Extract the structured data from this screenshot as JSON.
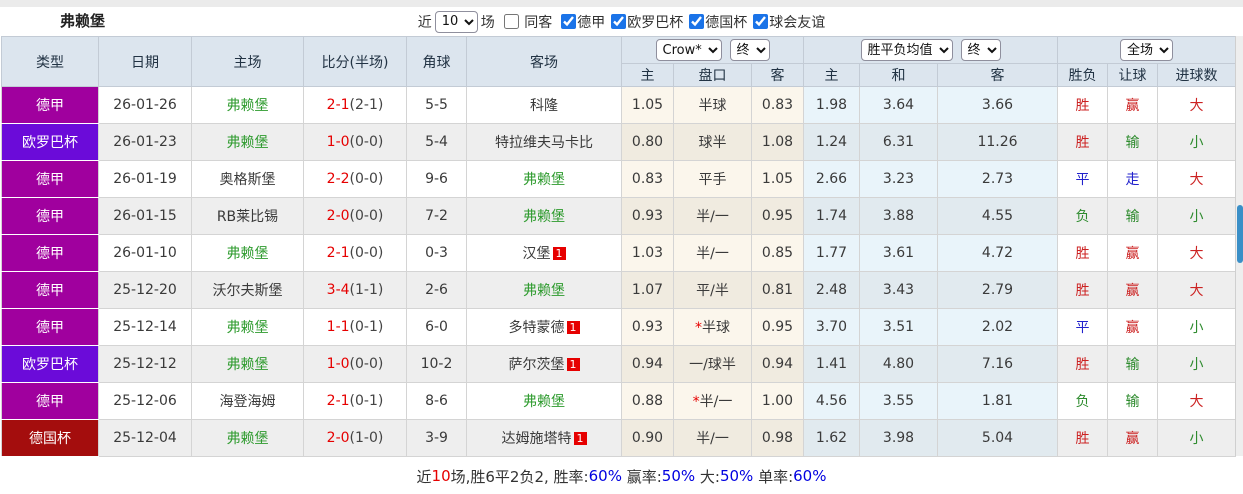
{
  "title": "弗赖堡",
  "topbar": {
    "recent_label": "近",
    "recent_value": "10",
    "games_label": "场",
    "same_opponent": {
      "label": "同客",
      "checked": false
    },
    "league_filters": [
      {
        "label": "德甲",
        "checked": true
      },
      {
        "label": "欧罗巴杯",
        "checked": true
      },
      {
        "label": "德国杯",
        "checked": true
      },
      {
        "label": "球会友谊",
        "checked": true
      }
    ]
  },
  "header": {
    "main_cols": [
      "类型",
      "日期",
      "主场",
      "比分(半场)",
      "角球",
      "客场"
    ],
    "odds_group": {
      "bookmaker_select": "Crow*",
      "time_select": "终"
    },
    "avg_group": {
      "name_select": "胜平负均值",
      "time_select": "终"
    },
    "result_group": {
      "scope_select": "全场"
    },
    "sub_cols": [
      "主",
      "盘口",
      "客",
      "主",
      "和",
      "客",
      "胜负",
      "让球",
      "进球数"
    ]
  },
  "highlight_team": "弗赖堡",
  "league_colors": {
    "德甲": "#a0009e",
    "欧罗巴杯": "#6b0bd9",
    "德国杯": "#a40d0d"
  },
  "value_colors": {
    "胜": "v-red",
    "平": "v-blue",
    "负": "v-green",
    "赢": "v-red",
    "走": "v-blue",
    "输": "v-green",
    "大": "v-red",
    "小": "v-green"
  },
  "rows": [
    {
      "league": "德甲",
      "date": "26-01-26",
      "home": "弗赖堡",
      "score": "2-1",
      "half": "(2-1)",
      "corners": "5-5",
      "away": "科隆",
      "away_badge": "",
      "odds_home": "1.05",
      "handicap": "半球",
      "handicap_star": false,
      "odds_away": "0.83",
      "avg_home": "1.98",
      "avg_draw": "3.64",
      "avg_away": "3.66",
      "result": "胜",
      "let_result": "赢",
      "goals": "大"
    },
    {
      "league": "欧罗巴杯",
      "date": "26-01-23",
      "home": "弗赖堡",
      "score": "1-0",
      "half": "(0-0)",
      "corners": "5-4",
      "away": "特拉维夫马卡比",
      "away_badge": "",
      "odds_home": "0.80",
      "handicap": "球半",
      "handicap_star": false,
      "odds_away": "1.08",
      "avg_home": "1.24",
      "avg_draw": "6.31",
      "avg_away": "11.26",
      "result": "胜",
      "let_result": "输",
      "goals": "小"
    },
    {
      "league": "德甲",
      "date": "26-01-19",
      "home": "奥格斯堡",
      "score": "2-2",
      "half": "(0-0)",
      "corners": "9-6",
      "away": "弗赖堡",
      "away_badge": "",
      "odds_home": "0.83",
      "handicap": "平手",
      "handicap_star": false,
      "odds_away": "1.05",
      "avg_home": "2.66",
      "avg_draw": "3.23",
      "avg_away": "2.73",
      "result": "平",
      "let_result": "走",
      "goals": "大"
    },
    {
      "league": "德甲",
      "date": "26-01-15",
      "home": "RB莱比锡",
      "score": "2-0",
      "half": "(0-0)",
      "corners": "7-2",
      "away": "弗赖堡",
      "away_badge": "",
      "odds_home": "0.93",
      "handicap": "半/一",
      "handicap_star": false,
      "odds_away": "0.95",
      "avg_home": "1.74",
      "avg_draw": "3.88",
      "avg_away": "4.55",
      "result": "负",
      "let_result": "输",
      "goals": "小"
    },
    {
      "league": "德甲",
      "date": "26-01-10",
      "home": "弗赖堡",
      "score": "2-1",
      "half": "(0-0)",
      "corners": "0-3",
      "away": "汉堡",
      "away_badge": "1",
      "odds_home": "1.03",
      "handicap": "半/一",
      "handicap_star": false,
      "odds_away": "0.85",
      "avg_home": "1.77",
      "avg_draw": "3.61",
      "avg_away": "4.72",
      "result": "胜",
      "let_result": "赢",
      "goals": "大"
    },
    {
      "league": "德甲",
      "date": "25-12-20",
      "home": "沃尔夫斯堡",
      "score": "3-4",
      "half": "(1-1)",
      "corners": "2-6",
      "away": "弗赖堡",
      "away_badge": "",
      "odds_home": "1.07",
      "handicap": "平/半",
      "handicap_star": false,
      "odds_away": "0.81",
      "avg_home": "2.48",
      "avg_draw": "3.43",
      "avg_away": "2.79",
      "result": "胜",
      "let_result": "赢",
      "goals": "大"
    },
    {
      "league": "德甲",
      "date": "25-12-14",
      "home": "弗赖堡",
      "score": "1-1",
      "half": "(0-1)",
      "corners": "6-0",
      "away": "多特蒙德",
      "away_badge": "1",
      "odds_home": "0.93",
      "handicap": "半球",
      "handicap_star": true,
      "odds_away": "0.95",
      "avg_home": "3.70",
      "avg_draw": "3.51",
      "avg_away": "2.02",
      "result": "平",
      "let_result": "赢",
      "goals": "小"
    },
    {
      "league": "欧罗巴杯",
      "date": "25-12-12",
      "home": "弗赖堡",
      "score": "1-0",
      "half": "(0-0)",
      "corners": "10-2",
      "away": "萨尔茨堡",
      "away_badge": "1",
      "odds_home": "0.94",
      "handicap": "一/球半",
      "handicap_star": false,
      "odds_away": "0.94",
      "avg_home": "1.41",
      "avg_draw": "4.80",
      "avg_away": "7.16",
      "result": "胜",
      "let_result": "输",
      "goals": "小"
    },
    {
      "league": "德甲",
      "date": "25-12-06",
      "home": "海登海姆",
      "score": "2-1",
      "half": "(0-1)",
      "corners": "8-6",
      "away": "弗赖堡",
      "away_badge": "",
      "odds_home": "0.88",
      "handicap": "半/一",
      "handicap_star": true,
      "odds_away": "1.00",
      "avg_home": "4.56",
      "avg_draw": "3.55",
      "avg_away": "1.81",
      "result": "负",
      "let_result": "输",
      "goals": "大"
    },
    {
      "league": "德国杯",
      "date": "25-12-04",
      "home": "弗赖堡",
      "score": "2-0",
      "half": "(1-0)",
      "corners": "3-9",
      "away": "达姆施塔特",
      "away_badge": "1",
      "odds_home": "0.90",
      "handicap": "半/一",
      "handicap_star": false,
      "odds_away": "0.98",
      "avg_home": "1.62",
      "avg_draw": "3.98",
      "avg_away": "5.04",
      "result": "胜",
      "let_result": "赢",
      "goals": "小"
    }
  ],
  "footer": {
    "parts": [
      {
        "text": "近",
        "color": "f-dark"
      },
      {
        "text": "10",
        "color": "f-red"
      },
      {
        "text": "场,胜6平2负2, 胜率:",
        "color": "f-dark"
      },
      {
        "text": "60%",
        "color": "f-blue"
      },
      {
        "text": " 赢率:",
        "color": "f-dark"
      },
      {
        "text": "50%",
        "color": "f-blue"
      },
      {
        "text": " 大:",
        "color": "f-dark"
      },
      {
        "text": "50%",
        "color": "f-blue"
      },
      {
        "text": " 单率:",
        "color": "f-dark"
      },
      {
        "text": "60%",
        "color": "f-blue"
      }
    ]
  }
}
